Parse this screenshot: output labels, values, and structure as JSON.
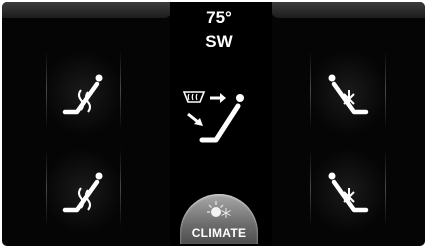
{
  "header": {
    "temperature": "75°",
    "direction": "SW"
  },
  "zones": {
    "front_left": {
      "icon": "heated-seat-icon"
    },
    "rear_left": {
      "icon": "heated-seat-icon"
    },
    "front_right": {
      "icon": "cooled-seat-icon"
    },
    "rear_right": {
      "icon": "cooled-seat-icon"
    }
  },
  "center": {
    "vent_icon": "defrost-airflow-icon"
  },
  "bottom": {
    "climate_label": "CLIMATE",
    "climate_icon": "climate-sun-snow-icon"
  },
  "colors": {
    "background": "#050505",
    "text": "#ffffff",
    "bar": "#2c2c2c",
    "button": "#8a8a8a"
  }
}
